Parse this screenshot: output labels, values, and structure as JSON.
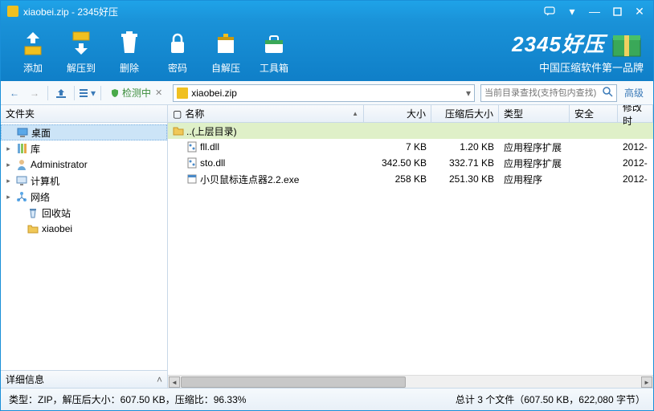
{
  "titlebar": {
    "title": "xiaobei.zip - 2345好压"
  },
  "toolbar": {
    "add": "添加",
    "extract": "解压到",
    "delete": "删除",
    "password": "密码",
    "sfx": "自解压",
    "tools": "工具箱"
  },
  "brand": {
    "logo": "2345好压",
    "sub": "中国压缩软件第一品牌"
  },
  "nav": {
    "scan": "检测中",
    "path": "xiaobei.zip",
    "search_placeholder": "当前目录查找(支持包内查找)",
    "advanced": "高级"
  },
  "sidebar": {
    "header": "文件夹",
    "items": [
      {
        "label": "桌面",
        "expand": "",
        "icon": "desktop",
        "selected": true,
        "indent": 0
      },
      {
        "label": "库",
        "expand": "▸",
        "icon": "library",
        "indent": 0
      },
      {
        "label": "Administrator",
        "expand": "▸",
        "icon": "user",
        "indent": 0
      },
      {
        "label": "计算机",
        "expand": "▸",
        "icon": "computer",
        "indent": 0
      },
      {
        "label": "网络",
        "expand": "▸",
        "icon": "network",
        "indent": 0
      },
      {
        "label": "回收站",
        "expand": "",
        "icon": "recycle",
        "indent": 1
      },
      {
        "label": "xiaobei",
        "expand": "",
        "icon": "folder",
        "indent": 1
      }
    ],
    "details": "详细信息"
  },
  "columns": {
    "name": "名称",
    "size": "大小",
    "csize": "压缩后大小",
    "type": "类型",
    "safe": "安全",
    "date": "修改时"
  },
  "files": {
    "up": "..(上层目录)",
    "rows": [
      {
        "name": "fll.dll",
        "size": "7 KB",
        "csize": "1.20 KB",
        "type": "应用程序扩展",
        "safe": "",
        "date": "2012-",
        "icon": "dll"
      },
      {
        "name": "sto.dll",
        "size": "342.50 KB",
        "csize": "332.71 KB",
        "type": "应用程序扩展",
        "safe": "",
        "date": "2012-",
        "icon": "dll"
      },
      {
        "name": "小贝鼠标连点器2.2.exe",
        "size": "258 KB",
        "csize": "251.30 KB",
        "type": "应用程序",
        "safe": "",
        "date": "2012-",
        "icon": "exe"
      }
    ]
  },
  "status": {
    "left": "类型：ZIP，解压后大小：607.50 KB，压缩比：96.33%",
    "right": "总计 3 个文件（607.50 KB，622,080 字节）"
  }
}
